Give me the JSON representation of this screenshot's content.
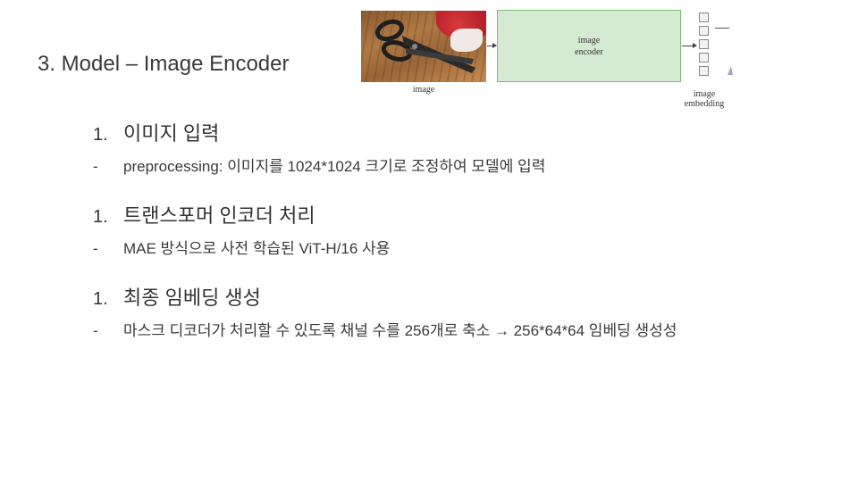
{
  "slide": {
    "title": "3. Model – Image Encoder"
  },
  "figure": {
    "image_caption": "image",
    "encoder_line1": "image",
    "encoder_line2": "encoder",
    "embedding_line1": "image",
    "embedding_line2": "embedding",
    "encoder_fill": "#d5ead2",
    "encoder_border": "#7cbb73"
  },
  "sections": [
    {
      "number": "1.",
      "heading": "이미지 입력",
      "bullet_marker": "-",
      "bullet": "preprocessing: 이미지를 1024*1024 크기로 조정하여 모델에 입력"
    },
    {
      "number": "1.",
      "heading": "트랜스포머 인코더 처리",
      "bullet_marker": "-",
      "bullet": "MAE 방식으로 사전 학습된 ViT-H/16 사용"
    },
    {
      "number": "1.",
      "heading": "최종 임베딩 생성",
      "bullet_marker": "-",
      "bullet": "마스크 디코더가 처리할 수 있도록 채널 수를 256개로 축소 → 256*64*64 임베딩 생성성"
    }
  ]
}
